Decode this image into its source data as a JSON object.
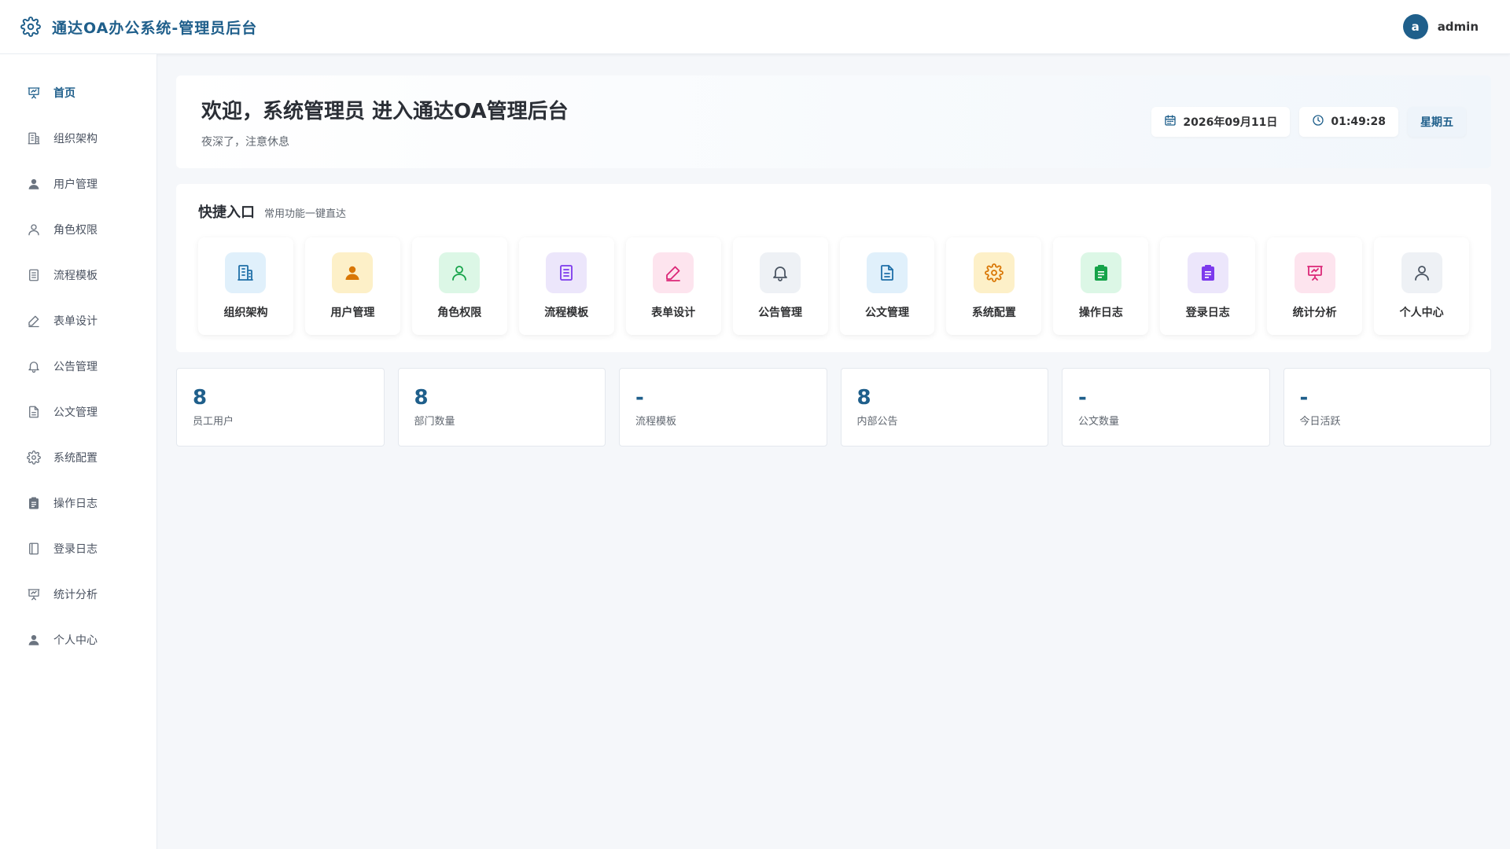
{
  "header": {
    "title": "通达OA办公系统-管理员后台",
    "brand_icon": "gear-icon",
    "avatar_initial": "a",
    "username": "admin"
  },
  "sidebar": {
    "items": [
      {
        "label": "首页",
        "icon": "presentation-chart-icon",
        "active": true
      },
      {
        "label": "组织架构",
        "icon": "building-icon"
      },
      {
        "label": "用户管理",
        "icon": "user-solid-icon"
      },
      {
        "label": "角色权限",
        "icon": "user-outline-icon"
      },
      {
        "label": "流程模板",
        "icon": "document-list-icon"
      },
      {
        "label": "表单设计",
        "icon": "pencil-icon"
      },
      {
        "label": "公告管理",
        "icon": "bell-icon"
      },
      {
        "label": "公文管理",
        "icon": "document-icon"
      },
      {
        "label": "系统配置",
        "icon": "gear-icon"
      },
      {
        "label": "操作日志",
        "icon": "clipboard-icon"
      },
      {
        "label": "登录日志",
        "icon": "notebook-icon"
      },
      {
        "label": "统计分析",
        "icon": "presentation-chart-icon"
      },
      {
        "label": "个人中心",
        "icon": "user-solid-icon"
      }
    ]
  },
  "welcome": {
    "title": "欢迎，系统管理员 进入通达OA管理后台",
    "subtitle": "夜深了，注意休息",
    "date": "2026年09月11日",
    "time": "01:49:28",
    "weekday": "星期五"
  },
  "quick": {
    "title": "快捷入口",
    "subtitle": "常用功能一键直达",
    "tiles": [
      {
        "label": "组织架构",
        "icon": "building-icon",
        "bg": "#e0f0fb",
        "fg": "#1f6fa8"
      },
      {
        "label": "用户管理",
        "icon": "user-solid-icon",
        "bg": "#fdf0c8",
        "fg": "#d97706"
      },
      {
        "label": "角色权限",
        "icon": "user-outline-icon",
        "bg": "#dcf7e6",
        "fg": "#16a34a"
      },
      {
        "label": "流程模板",
        "icon": "document-list-icon",
        "bg": "#ece6fb",
        "fg": "#7c3aed"
      },
      {
        "label": "表单设计",
        "icon": "pencil-icon",
        "bg": "#fde4ee",
        "fg": "#db2777"
      },
      {
        "label": "公告管理",
        "icon": "bell-icon",
        "bg": "#eef1f5",
        "fg": "#4b5563"
      },
      {
        "label": "公文管理",
        "icon": "document-icon",
        "bg": "#e0f0fb",
        "fg": "#1f6fa8"
      },
      {
        "label": "系统配置",
        "icon": "gear-icon",
        "bg": "#fdf0c8",
        "fg": "#d97706"
      },
      {
        "label": "操作日志",
        "icon": "clipboard-icon",
        "bg": "#dcf7e6",
        "fg": "#16a34a"
      },
      {
        "label": "登录日志",
        "icon": "clipboard-icon",
        "bg": "#ece6fb",
        "fg": "#7c3aed"
      },
      {
        "label": "统计分析",
        "icon": "presentation-chart-icon",
        "bg": "#fde4ee",
        "fg": "#db2777"
      },
      {
        "label": "个人中心",
        "icon": "user-outline-icon",
        "bg": "#eef1f5",
        "fg": "#4b5563"
      }
    ]
  },
  "stats": [
    {
      "value": "8",
      "label": "员工用户"
    },
    {
      "value": "8",
      "label": "部门数量"
    },
    {
      "value": "-",
      "label": "流程模板"
    },
    {
      "value": "8",
      "label": "内部公告"
    },
    {
      "value": "-",
      "label": "公文数量"
    },
    {
      "value": "-",
      "label": "今日活跃"
    }
  ],
  "colors": {
    "accent": "#1f5f8b",
    "background": "#f5f7fa"
  }
}
